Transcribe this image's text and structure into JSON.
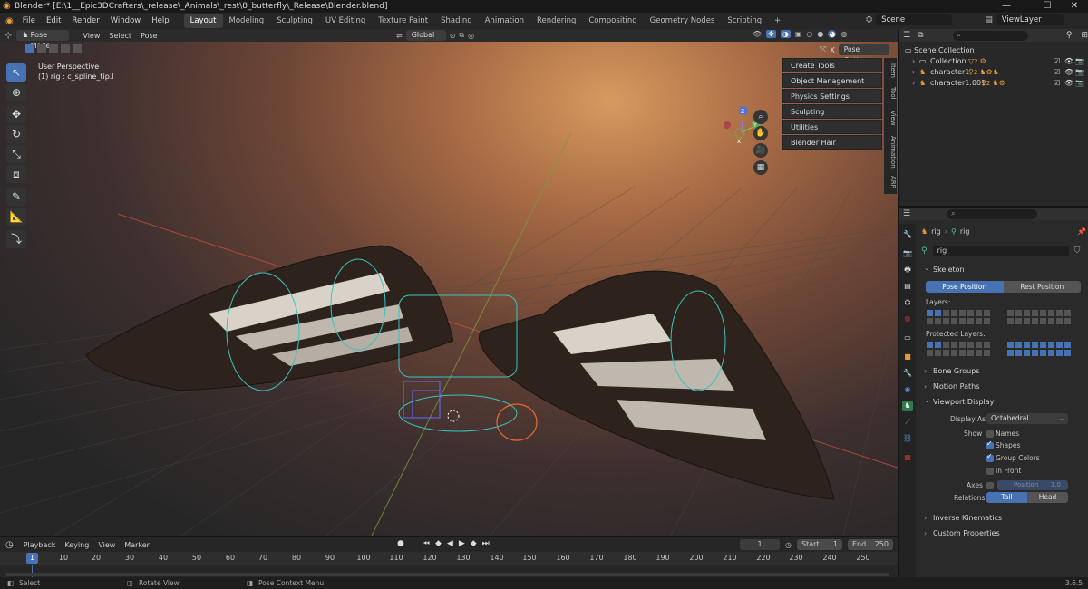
{
  "window": {
    "title": "Blender* [E:\\1__Epic3DCrafters\\_release\\_Animals\\_rest\\8_butterfly\\_Release\\Blender.blend]",
    "minimize": "—",
    "maximize": "☐",
    "close": "✕"
  },
  "menu": [
    "File",
    "Edit",
    "Render",
    "Window",
    "Help"
  ],
  "workspaces": [
    "Layout",
    "Modeling",
    "Sculpting",
    "UV Editing",
    "Texture Paint",
    "Shading",
    "Animation",
    "Rendering",
    "Compositing",
    "Geometry Nodes",
    "Scripting"
  ],
  "workspace_add": "+",
  "scene": {
    "scene_name": "Scene",
    "view_layer": "ViewLayer"
  },
  "viewport_header": {
    "mode": "Pose Mode",
    "menus": [
      "View",
      "Select",
      "Pose"
    ],
    "transform_orientation": "Global",
    "pose_options": "Pose Options"
  },
  "viewport": {
    "view_name": "User Perspective",
    "active_info": "(1) rig : c_spline_tip.l"
  },
  "n_panel": {
    "items": [
      "Create Tools",
      "Object Management",
      "Physics Settings",
      "Sculpting",
      "Utilities",
      "Blender Hair"
    ],
    "tabs": [
      "Item",
      "Tool",
      "View",
      "Animation",
      "ARP"
    ]
  },
  "gizmo": {
    "z": "Z",
    "y": "Y",
    "x": "X"
  },
  "outliner": {
    "root": "Scene Collection",
    "rows": [
      {
        "name": "Collection",
        "badge": "2"
      },
      {
        "name": "character1",
        "badge": "2"
      },
      {
        "name": "character1.001",
        "badge": "2"
      }
    ]
  },
  "properties": {
    "breadcrumb_obj": "rig",
    "breadcrumb_data": "rig",
    "data_name": "rig",
    "sections": {
      "skeleton": "Skeleton",
      "bone_groups": "Bone Groups",
      "motion_paths": "Motion Paths",
      "viewport_display": "Viewport Display",
      "inverse_kinematics": "Inverse Kinematics",
      "custom_properties": "Custom Properties"
    },
    "pose_position": "Pose Position",
    "rest_position": "Rest Position",
    "layers_label": "Layers:",
    "protected_layers_label": "Protected Layers:",
    "display_as_label": "Display As",
    "display_as_value": "Octahedral",
    "show_label": "Show",
    "show_names": "Names",
    "show_shapes": "Shapes",
    "show_group_colors": "Group Colors",
    "show_in_front": "In Front",
    "axes_label": "Axes",
    "axes_position_label": "Position",
    "axes_position_value": "1.0",
    "relations_label": "Relations",
    "relations_tail": "Tail",
    "relations_head": "Head"
  },
  "timeline": {
    "menus": [
      "Playback",
      "Keying",
      "View",
      "Marker"
    ],
    "current_frame": "1",
    "start_label": "Start",
    "start_value": "1",
    "end_label": "End",
    "end_value": "250",
    "ticks": [
      "10",
      "20",
      "30",
      "40",
      "50",
      "60",
      "70",
      "80",
      "90",
      "100",
      "110",
      "120",
      "130",
      "140",
      "150",
      "160",
      "170",
      "180",
      "190",
      "200",
      "210",
      "220",
      "230",
      "240",
      "250"
    ],
    "playhead_label": "1"
  },
  "status": {
    "select": "Select",
    "rotate": "Rotate View",
    "context": "Pose Context Menu",
    "version": "3.6.5"
  },
  "colors": {
    "accent": "#4772b3",
    "panel": "#2a2a2a",
    "header": "#272727"
  }
}
